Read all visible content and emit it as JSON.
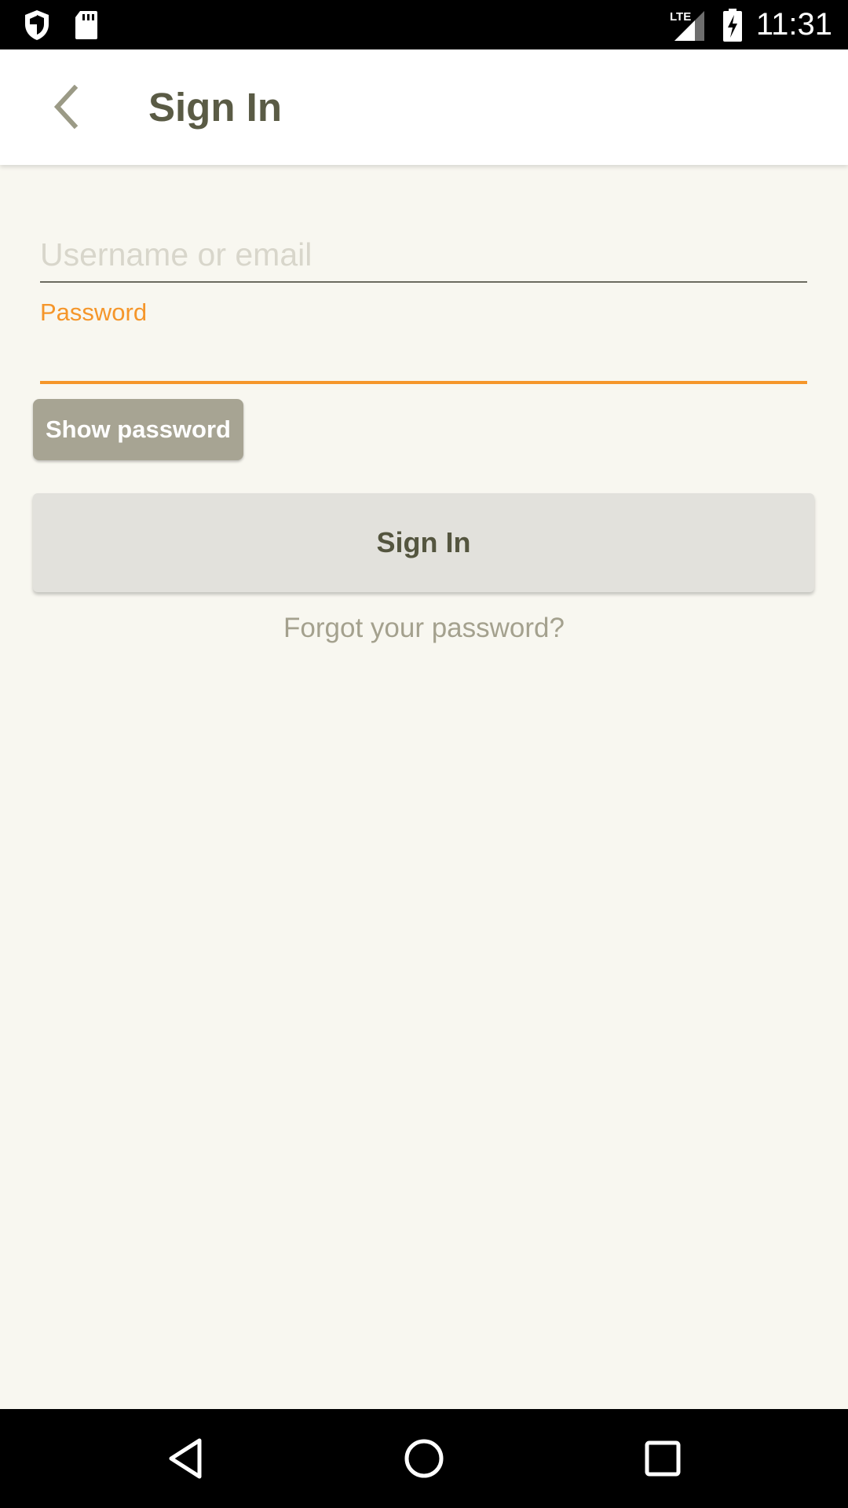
{
  "status_bar": {
    "time": "11:31",
    "network_label": "LTE",
    "icons": [
      "shield-icon",
      "sdcard-icon",
      "signal-icon",
      "battery-charging-icon"
    ]
  },
  "app_bar": {
    "title": "Sign In",
    "back_icon": "chevron-left-icon"
  },
  "form": {
    "username": {
      "placeholder": "Username or email",
      "value": ""
    },
    "password": {
      "label": "Password",
      "value": ""
    },
    "show_password_label": "Show password",
    "sign_in_label": "Sign In",
    "forgot_password_label": "Forgot your password?"
  },
  "nav_bar": {
    "icons": [
      "nav-back-icon",
      "nav-home-icon",
      "nav-recents-icon"
    ]
  },
  "colors": {
    "background": "#f8f7f0",
    "accent": "#f5962a",
    "title_text": "#5a5b45",
    "show_password_bg": "#a7a493",
    "sign_in_bg": "#e2e1dc",
    "link_text": "#a4a18e"
  }
}
